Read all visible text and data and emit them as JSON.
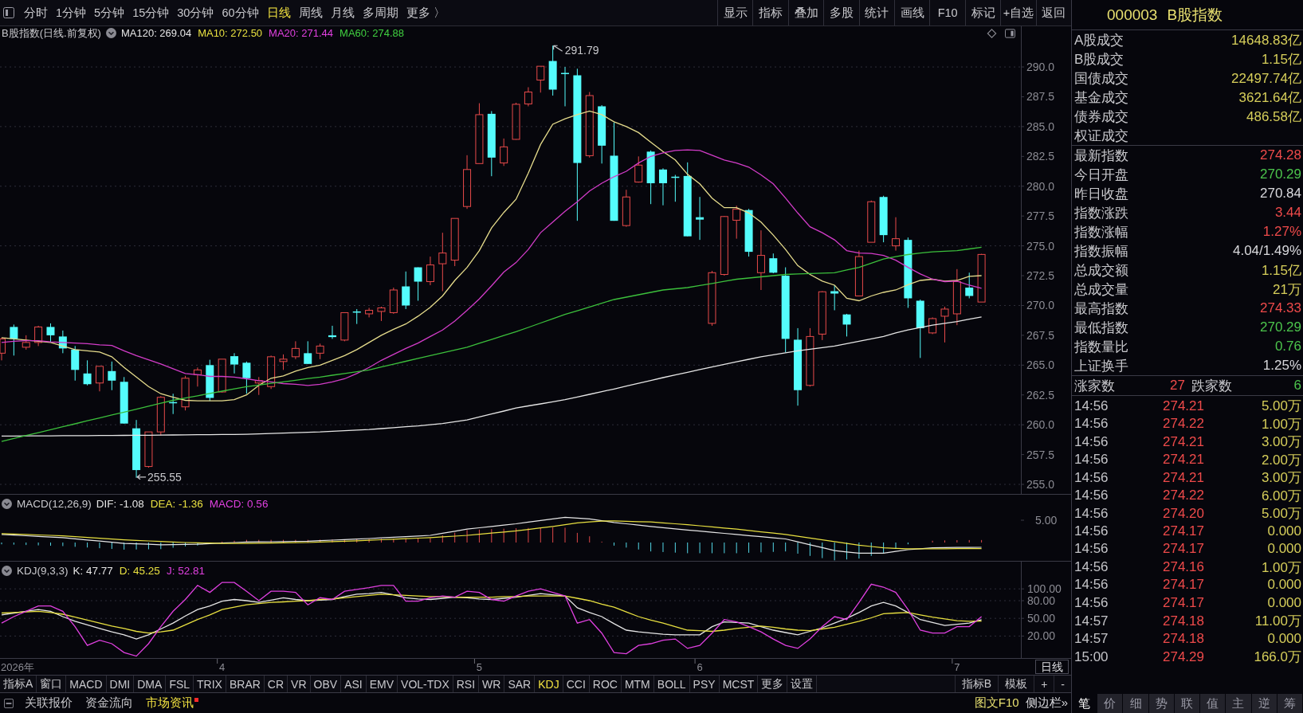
{
  "toolbar": {
    "periods": [
      {
        "label": "分时",
        "selected": false
      },
      {
        "label": "1分钟",
        "selected": false
      },
      {
        "label": "5分钟",
        "selected": false
      },
      {
        "label": "15分钟",
        "selected": false
      },
      {
        "label": "30分钟",
        "selected": false
      },
      {
        "label": "60分钟",
        "selected": false
      },
      {
        "label": "日线",
        "selected": true
      },
      {
        "label": "周线",
        "selected": false
      },
      {
        "label": "月线",
        "selected": false
      },
      {
        "label": "多周期",
        "selected": false
      },
      {
        "label": "更多 〉",
        "selected": false
      }
    ],
    "tools": [
      "显示",
      "指标",
      "叠加",
      "多股",
      "统计",
      "画线",
      "F10",
      "标记",
      "+自选",
      "返回"
    ]
  },
  "main_pane": {
    "title": "B股指数(日线.前复权)",
    "legend": [
      {
        "label": "MA120: 269.04",
        "color": "#e6e6e6"
      },
      {
        "label": "MA10: 272.50",
        "color": "#e8e040"
      },
      {
        "label": "MA20: 271.44",
        "color": "#e040e0"
      },
      {
        "label": "MA60: 274.88",
        "color": "#40d040"
      }
    ],
    "chart_data": [
      {
        "type": "candlestick",
        "ylim": [
          254.2,
          293.41
        ],
        "grid": true,
        "yticks": [
          {
            "value": 255,
            "label": "255.0"
          },
          {
            "value": 257.5,
            "label": "257.5"
          },
          {
            "value": 260,
            "label": "260.0"
          },
          {
            "value": 262.5,
            "label": "262.5"
          },
          {
            "value": 265,
            "label": "265.0"
          },
          {
            "value": 267.5,
            "label": "267.5"
          },
          {
            "value": 270,
            "label": "270.0"
          },
          {
            "value": 272.5,
            "label": "272.5"
          },
          {
            "value": 275,
            "label": "275.0"
          },
          {
            "value": 277.5,
            "label": "277.5"
          },
          {
            "value": 280,
            "label": "280.0"
          },
          {
            "value": 282.5,
            "label": "282.5"
          },
          {
            "value": 285,
            "label": "285.0"
          },
          {
            "value": 287.5,
            "label": "287.5"
          },
          {
            "value": 290,
            "label": "290.0"
          }
        ],
        "annotations": [
          "291.79",
          "255.55"
        ],
        "ohlc": [
          [
            266.0,
            267.3,
            265.4,
            267.2
          ],
          [
            268.2,
            268.4,
            265.8,
            267.2
          ],
          [
            266.5,
            267.5,
            266.3,
            266.9
          ],
          [
            266.9,
            268.3,
            266.6,
            268.2
          ],
          [
            268.2,
            268.5,
            266.9,
            267.5
          ],
          [
            267.4,
            267.9,
            266.0,
            266.4
          ],
          [
            266.3,
            266.6,
            263.7,
            264.6
          ],
          [
            264.3,
            265.4,
            263.3,
            263.4
          ],
          [
            263.5,
            264.9,
            262.8,
            264.9
          ],
          [
            264.5,
            265.3,
            262.9,
            263.7
          ],
          [
            263.6,
            264.0,
            260.1,
            260.1
          ],
          [
            259.7,
            260.4,
            255.55,
            256.2
          ],
          [
            256.5,
            259.4,
            256.4,
            259.4
          ],
          [
            259.4,
            262.4,
            259.1,
            262.3
          ],
          [
            261.9,
            262.6,
            260.9,
            261.8
          ],
          [
            261.5,
            264.1,
            261.2,
            263.9
          ],
          [
            264.2,
            264.8,
            263.2,
            264.6
          ],
          [
            265.0,
            265.45,
            262.0,
            262.25
          ],
          [
            262.75,
            265.5,
            262.7,
            265.5
          ],
          [
            265.75,
            266.0,
            264.3,
            265.05
          ],
          [
            265.2,
            265.3,
            262.6,
            263.9
          ],
          [
            263.5,
            264.0,
            262.5,
            263.7
          ],
          [
            263.2,
            265.8,
            263.0,
            265.7
          ],
          [
            265.3,
            265.9,
            264.6,
            265.5
          ],
          [
            265.7,
            267.0,
            265.5,
            266.4
          ],
          [
            266.0,
            267.0,
            265.1,
            265.1
          ],
          [
            266.0,
            266.8,
            265.5,
            266.6
          ],
          [
            267.5,
            268.3,
            267.2,
            267.35
          ],
          [
            267.1,
            269.4,
            267.0,
            269.4
          ],
          [
            269.5,
            269.7,
            268.45,
            269.4
          ],
          [
            269.3,
            269.8,
            269.0,
            269.6
          ],
          [
            269.5,
            269.9,
            268.7,
            269.8
          ],
          [
            269.4,
            271.5,
            269.3,
            271.3
          ],
          [
            271.6,
            272.85,
            269.7,
            270.0
          ],
          [
            273.2,
            273.2,
            270.4,
            272.0
          ],
          [
            272.0,
            274.1,
            271.7,
            273.4
          ],
          [
            273.5,
            276.1,
            271.2,
            274.4
          ],
          [
            273.8,
            277.3,
            273.3,
            277.3
          ],
          [
            278.3,
            282.6,
            278.1,
            281.4
          ],
          [
            281.9,
            286.96,
            281.9,
            286.0
          ],
          [
            286.07,
            286.3,
            280.84,
            282.4
          ],
          [
            281.95,
            284.0,
            281.7,
            283.3
          ],
          [
            283.93,
            287.0,
            283.9,
            286.87
          ],
          [
            286.9,
            288.3,
            286.7,
            287.9
          ],
          [
            288.9,
            290.06,
            287.85,
            290.06
          ],
          [
            290.5,
            291.79,
            287.6,
            288.1
          ],
          [
            289.5,
            290.0,
            286.7,
            289.4
          ],
          [
            289.3,
            289.85,
            277.1,
            281.95
          ],
          [
            282.56,
            287.9,
            282.4,
            287.6
          ],
          [
            286.7,
            286.8,
            281.9,
            283.4
          ],
          [
            282.56,
            285.35,
            277.1,
            277.1
          ],
          [
            276.7,
            279.7,
            276.6,
            279.1
          ],
          [
            280.35,
            282.5,
            280.3,
            281.77
          ],
          [
            282.9,
            283.0,
            278.5,
            280.25
          ],
          [
            281.4,
            281.5,
            278.4,
            280.25
          ],
          [
            280.8,
            280.95,
            278.7,
            280.7
          ],
          [
            280.86,
            282.0,
            275.8,
            275.8
          ],
          [
            277.4,
            279.1,
            275.5,
            277.2
          ],
          [
            268.5,
            272.9,
            268.3,
            272.75
          ],
          [
            272.6,
            277.5,
            272.5,
            277.46
          ],
          [
            277.15,
            278.37,
            275.6,
            278.07
          ],
          [
            278.0,
            278.1,
            274.1,
            274.5
          ],
          [
            272.75,
            276.3,
            271.3,
            274.2
          ],
          [
            273.96,
            274.36,
            272.7,
            272.75
          ],
          [
            272.5,
            273.2,
            266.07,
            267.2
          ],
          [
            267.13,
            268.1,
            261.6,
            262.9
          ],
          [
            263.3,
            268.1,
            263.2,
            267.4
          ],
          [
            267.6,
            271.2,
            267.1,
            271.15
          ],
          [
            271.2,
            271.7,
            269.6,
            271.0
          ],
          [
            269.25,
            269.3,
            267.4,
            268.4
          ],
          [
            270.8,
            274.6,
            270.8,
            274.1
          ],
          [
            275.3,
            278.8,
            275.3,
            278.7
          ],
          [
            279.1,
            279.2,
            275.3,
            275.9
          ],
          [
            275.0,
            277.4,
            274.6,
            275.6
          ],
          [
            275.5,
            275.7,
            269.8,
            270.6
          ],
          [
            270.4,
            270.5,
            265.6,
            268.1
          ],
          [
            267.7,
            269.0,
            267.6,
            268.9
          ],
          [
            269.1,
            269.9,
            266.9,
            269.7
          ],
          [
            269.3,
            273.05,
            268.35,
            272.0
          ],
          [
            271.5,
            272.75,
            270.6,
            270.8
          ],
          [
            270.29,
            274.33,
            270.29,
            274.28
          ]
        ],
        "series": [
          {
            "type": "line",
            "color": "#e6e6e6",
            "values": [
              259.05,
              259.05,
              259.06,
              259.06,
              259.07,
              259.08,
              259.08,
              259.09,
              259.1,
              259.1,
              259.11,
              259.12,
              259.12,
              259.13,
              259.14,
              259.15,
              259.16,
              259.17,
              259.18,
              259.19,
              259.2,
              259.23,
              259.27,
              259.3,
              259.33,
              259.37,
              259.4,
              259.45,
              259.5,
              259.55,
              259.6,
              259.68,
              259.75,
              259.83,
              259.9,
              260.0,
              260.1,
              260.25,
              260.4,
              260.65,
              260.9,
              261.15,
              261.4,
              261.58,
              261.75,
              261.93,
              262.1,
              262.33,
              262.55,
              262.78,
              263.0,
              263.24,
              263.48,
              263.71,
              263.95,
              264.18,
              264.4,
              264.63,
              264.85,
              265.06,
              265.28,
              265.49,
              265.7,
              265.87,
              266.03,
              266.2,
              266.33,
              266.47,
              266.6,
              266.8,
              267.0,
              267.2,
              267.4,
              267.7,
              267.95,
              268.15,
              268.35,
              268.5,
              268.65,
              268.85,
              269.04
            ]
          },
          {
            "type": "line",
            "color": "#e6dc8c",
            "values": [
              267.3,
              267.2,
              267.1,
              267.0,
              266.9,
              266.6,
              266.3,
              266.2,
              266.1,
              265.7,
              264.8,
              264.0,
              263.2,
              262.6,
              262.3,
              262.05,
              262.0,
              262.0,
              262.0,
              262.1,
              262.5,
              263.3,
              263.9,
              264.1,
              264.5,
              264.8,
              265.0,
              265.4,
              265.8,
              266.3,
              266.9,
              267.5,
              268.0,
              268.45,
              269.1,
              269.85,
              270.8,
              272.1,
              273.2,
              274.6,
              276.5,
              277.8,
              278.9,
              281.1,
              283.5,
              285.2,
              285.65,
              286.0,
              286.3,
              286.0,
              285.4,
              285.0,
              284.5,
              283.7,
              282.9,
              282.2,
              281.0,
              280.2,
              279.0,
              278.2,
              278.2,
              277.76,
              277.0,
              275.9,
              274.7,
              273.35,
              272.6,
              272.05,
              271.7,
              270.6,
              270.4,
              270.8,
              271.1,
              271.3,
              271.75,
              272.1,
              272.2,
              272.05,
              272.1,
              272.45,
              272.5
            ]
          },
          {
            "type": "line",
            "color": "#d23cc8",
            "values": [
              266.9,
              267.0,
              267.05,
              267.05,
              266.95,
              266.9,
              266.85,
              266.8,
              266.7,
              266.65,
              266.2,
              265.8,
              265.45,
              265.1,
              264.7,
              264.3,
              264.2,
              264.05,
              264.05,
              264.0,
              263.85,
              263.7,
              263.6,
              263.45,
              263.4,
              263.3,
              263.4,
              263.6,
              263.85,
              264.3,
              264.8,
              265.4,
              265.9,
              266.4,
              266.85,
              267.4,
              267.95,
              268.7,
              269.6,
              270.55,
              271.65,
              272.8,
              273.6,
              274.7,
              276.1,
              277.0,
              277.9,
              278.7,
              279.6,
              280.25,
              280.8,
              281.25,
              281.95,
              282.5,
              282.8,
              283.0,
              283.05,
              283.0,
              282.6,
              282.2,
              281.95,
              281.6,
              280.95,
              280.2,
              279.0,
              277.76,
              276.6,
              276.1,
              275.5,
              274.6,
              274.4,
              274.36,
              274.2,
              273.8,
              273.2,
              272.65,
              272.2,
              272.0,
              272.05,
              271.7,
              271.44
            ]
          },
          {
            "type": "line",
            "color": "#3cc03c",
            "values": [
              258.6,
              258.85,
              259.1,
              259.34,
              259.59,
              259.83,
              260.08,
              260.33,
              260.57,
              260.82,
              261.06,
              261.31,
              261.56,
              261.8,
              262.05,
              262.24,
              262.43,
              262.62,
              262.82,
              263.01,
              263.2,
              263.33,
              263.47,
              263.6,
              263.73,
              263.87,
              264.0,
              264.15,
              264.3,
              264.45,
              264.6,
              264.84,
              265.08,
              265.32,
              265.56,
              265.8,
              266.03,
              266.27,
              266.5,
              266.83,
              267.15,
              267.48,
              267.8,
              268.16,
              268.53,
              268.89,
              269.25,
              269.56,
              269.88,
              270.19,
              270.5,
              270.7,
              270.9,
              271.1,
              271.3,
              271.4,
              271.5,
              271.68,
              271.85,
              272.03,
              272.2,
              272.3,
              272.4,
              272.5,
              272.6,
              272.64,
              272.68,
              272.71,
              272.75,
              272.98,
              273.2,
              273.55,
              273.9,
              274.09,
              274.27,
              274.39,
              274.5,
              274.55,
              274.6,
              274.74,
              274.88
            ]
          }
        ]
      }
    ]
  },
  "macd_pane": {
    "title": "MACD(12,26,9)",
    "legend": [
      {
        "label": "DIF: -1.08",
        "color": "#e6e6e6"
      },
      {
        "label": "DEA: -1.36",
        "color": "#e8e040"
      },
      {
        "label": "MACD: 0.56",
        "color": "#e040e0"
      }
    ],
    "scale_label": "5.00"
  },
  "kdj_pane": {
    "title": "KDJ(9,3,3)",
    "legend": [
      {
        "label": "K: 47.77",
        "color": "#e6e6e6"
      },
      {
        "label": "D: 45.25",
        "color": "#e8e040"
      },
      {
        "label": "J: 52.81",
        "color": "#e040e0"
      }
    ],
    "year_label": "2026年",
    "period_button": "日线",
    "chart_data": [
      {
        "type": "line",
        "ylim": [
          -17.3,
          146.2
        ],
        "grid": true,
        "yticks": [
          {
            "value": 20,
            "label": "20.00"
          },
          {
            "value": 50,
            "label": "50.00"
          },
          {
            "value": 80,
            "label": "80.00"
          },
          {
            "value": 100,
            "label": "100.00"
          }
        ],
        "categories": [
          null,
          null,
          null,
          null,
          null,
          null,
          null,
          null,
          null,
          null,
          null,
          null,
          null,
          null,
          null,
          null,
          null,
          null,
          "4",
          null,
          null,
          null,
          null,
          null,
          null,
          null,
          null,
          null,
          null,
          null,
          null,
          null,
          null,
          null,
          null,
          null,
          null,
          null,
          null,
          "5",
          null,
          null,
          null,
          null,
          null,
          null,
          null,
          null,
          null,
          null,
          null,
          null,
          null,
          null,
          null,
          null,
          null,
          "6",
          null,
          null,
          null,
          null,
          null,
          null,
          null,
          null,
          null,
          null,
          null,
          null,
          null,
          null,
          null,
          null,
          null,
          null,
          null,
          null,
          "7",
          null,
          null
        ],
        "series": [
          {
            "color": "#e6e6e6",
            "values": [
              56,
              59,
              62,
              65,
              62,
              53,
              45,
              39,
              33,
              27,
              22,
              15,
              22,
              32,
              42,
              54,
              65,
              71,
              79,
              82,
              80,
              77,
              81,
              85,
              82,
              80,
              81,
              82,
              87,
              91,
              92,
              94,
              90,
              85,
              83,
              82,
              84,
              86,
              85,
              83,
              82,
              84,
              86,
              89,
              92,
              90,
              88,
              68,
              60,
              53,
              41,
              30,
              27,
              25,
              23,
              22,
              22,
              22,
              36,
              44,
              43,
              42,
              36,
              30,
              26,
              22,
              28,
              34,
              42,
              50,
              60,
              71,
              77,
              71,
              60,
              48,
              43,
              38,
              40,
              42,
              47.77
            ]
          },
          {
            "color": "#e8e040",
            "values": [
              59,
              60,
              61,
              62,
              60,
              57,
              52,
              47,
              42,
              37,
              33,
              28,
              25,
              27,
              30,
              39,
              48,
              56,
              65,
              69,
              73,
              75,
              77,
              78,
              79,
              80,
              82,
              83,
              85,
              87,
              89,
              91,
              90,
              89,
              88,
              87,
              87,
              86,
              86,
              86,
              86,
              87,
              87,
              88,
              88,
              88,
              88,
              84,
              80,
              74,
              69,
              61,
              53,
              47,
              42,
              36,
              30,
              29,
              28,
              30,
              33,
              35,
              37,
              35,
              32,
              30,
              29,
              32,
              35,
              40,
              45,
              51,
              58,
              59,
              60,
              56,
              52,
              49,
              46,
              45,
              45.25
            ]
          },
          {
            "color": "#e040e0",
            "values": [
              42,
              53,
              62,
              71,
              71,
              62,
              36,
              4,
              13,
              7,
              -8,
              -14,
              7,
              36,
              62,
              82,
              106,
              94,
              111,
              111,
              96,
              80,
              96,
              96,
              94,
              73,
              85,
              82,
              96,
              99,
              102,
              106,
              106,
              79,
              79,
              85,
              88,
              86,
              96,
              94,
              82,
              79,
              88,
              96,
              100,
              94,
              88,
              42,
              48,
              25,
              -8,
              -10,
              4,
              7,
              13,
              15,
              -1,
              4,
              25,
              48,
              44,
              36,
              27,
              15,
              4,
              -1,
              15,
              36,
              53,
              48,
              77,
              108,
              103,
              94,
              65,
              30,
              25,
              25,
              36,
              36,
              52.81
            ]
          }
        ]
      }
    ]
  },
  "indicator_tabs": {
    "tabs": [
      {
        "label": "指标A",
        "selected": false
      },
      {
        "label": "窗口",
        "selected": false
      },
      {
        "label": "MACD",
        "selected": false
      },
      {
        "label": "DMI",
        "selected": false
      },
      {
        "label": "DMA",
        "selected": false
      },
      {
        "label": "FSL",
        "selected": false
      },
      {
        "label": "TRIX",
        "selected": false
      },
      {
        "label": "BRAR",
        "selected": false
      },
      {
        "label": "CR",
        "selected": false
      },
      {
        "label": "VR",
        "selected": false
      },
      {
        "label": "OBV",
        "selected": false
      },
      {
        "label": "ASI",
        "selected": false
      },
      {
        "label": "EMV",
        "selected": false
      },
      {
        "label": "VOL-TDX",
        "selected": false
      },
      {
        "label": "RSI",
        "selected": false
      },
      {
        "label": "WR",
        "selected": false
      },
      {
        "label": "SAR",
        "selected": false
      },
      {
        "label": "KDJ",
        "selected": true
      },
      {
        "label": "CCI",
        "selected": false
      },
      {
        "label": "ROC",
        "selected": false
      },
      {
        "label": "MTM",
        "selected": false
      },
      {
        "label": "BOLL",
        "selected": false
      },
      {
        "label": "PSY",
        "selected": false
      },
      {
        "label": "MCST",
        "selected": false
      },
      {
        "label": "更多",
        "selected": false
      },
      {
        "label": "设置",
        "selected": false
      }
    ],
    "right_tabs": [
      "指标B",
      "模板",
      "+",
      "-"
    ]
  },
  "status_bar": {
    "tabs": [
      {
        "label": "关联报价",
        "selected": false,
        "alert": false
      },
      {
        "label": "资金流向",
        "selected": false,
        "alert": false
      },
      {
        "label": "市场资讯",
        "selected": true,
        "alert": true
      }
    ],
    "links": [
      {
        "label": "图文F10",
        "selected": true
      },
      {
        "label": "侧边栏»",
        "selected": false
      }
    ]
  },
  "quote_panel": {
    "code": "000003",
    "name": "B股指数",
    "turnover": [
      {
        "label": "A股成交",
        "value": "14648.83亿",
        "color": "#d6ce5a"
      },
      {
        "label": "B股成交",
        "value": "1.15亿",
        "color": "#d6ce5a"
      },
      {
        "label": "国债成交",
        "value": "22497.74亿",
        "color": "#d6ce5a"
      },
      {
        "label": "基金成交",
        "value": "3621.64亿",
        "color": "#d6ce5a"
      },
      {
        "label": "债券成交",
        "value": "486.58亿",
        "color": "#d6ce5a"
      },
      {
        "label": "权证成交"
      }
    ],
    "stats": [
      {
        "label": "最新指数",
        "value": "274.28",
        "color": "#ee4a4a"
      },
      {
        "label": "今日开盘",
        "value": "270.29",
        "color": "#4cc44c"
      },
      {
        "label": "昨日收盘",
        "value": "270.84",
        "color": "#d8d8dc"
      },
      {
        "label": "指数涨跌",
        "value": "3.44",
        "color": "#ee4a4a"
      },
      {
        "label": "指数涨幅",
        "value": "1.27%",
        "color": "#ee4a4a"
      },
      {
        "label": "指数振幅",
        "value": "4.04/1.49%",
        "color": "#d8d8dc"
      },
      {
        "label": "总成交额",
        "value": "1.15亿",
        "color": "#d6ce5a"
      },
      {
        "label": "总成交量",
        "value": "21万",
        "color": "#d6ce5a"
      },
      {
        "label": "最高指数",
        "value": "274.33",
        "color": "#ee4a4a"
      },
      {
        "label": "最低指数",
        "value": "270.29",
        "color": "#4cc44c"
      },
      {
        "label": "指数量比",
        "value": "0.76",
        "color": "#4cc44c"
      },
      {
        "label": "上证换手",
        "value": "1.25%",
        "color": "#d8d8dc"
      }
    ],
    "breadth": {
      "up_label": "涨家数",
      "up_count": "27",
      "down_label": "跌家数",
      "down_count": "6"
    },
    "ticks": [
      {
        "time": "14:56",
        "price": "274.21",
        "volume": "5.00万",
        "color": "#ee4a4a"
      },
      {
        "time": "14:56",
        "price": "274.22",
        "volume": "1.00万",
        "color": "#ee4a4a"
      },
      {
        "time": "14:56",
        "price": "274.21",
        "volume": "3.00万",
        "color": "#ee4a4a"
      },
      {
        "time": "14:56",
        "price": "274.21",
        "volume": "2.00万",
        "color": "#ee4a4a"
      },
      {
        "time": "14:56",
        "price": "274.21",
        "volume": "3.00万",
        "color": "#ee4a4a"
      },
      {
        "time": "14:56",
        "price": "274.22",
        "volume": "6.00万",
        "color": "#ee4a4a"
      },
      {
        "time": "14:56",
        "price": "274.20",
        "volume": "5.00万",
        "color": "#ee4a4a"
      },
      {
        "time": "14:56",
        "price": "274.17",
        "volume": "0.000",
        "color": "#ee4a4a"
      },
      {
        "time": "14:56",
        "price": "274.17",
        "volume": "0.000",
        "color": "#ee4a4a"
      },
      {
        "time": "14:56",
        "price": "274.16",
        "volume": "1.00万",
        "color": "#ee4a4a"
      },
      {
        "time": "14:56",
        "price": "274.17",
        "volume": "0.000",
        "color": "#ee4a4a"
      },
      {
        "time": "14:56",
        "price": "274.17",
        "volume": "0.000",
        "color": "#ee4a4a"
      },
      {
        "time": "14:57",
        "price": "274.18",
        "volume": "11.00万",
        "color": "#ee4a4a"
      },
      {
        "time": "14:57",
        "price": "274.18",
        "volume": "0.000",
        "color": "#ee4a4a"
      },
      {
        "time": "15:00",
        "price": "274.29",
        "volume": "166.0万",
        "color": "#ee4a4a"
      }
    ],
    "tabs": [
      {
        "label": "笔",
        "selected": true
      },
      {
        "label": "价",
        "selected": false
      },
      {
        "label": "细",
        "selected": false
      },
      {
        "label": "势",
        "selected": false
      },
      {
        "label": "联",
        "selected": false
      },
      {
        "label": "值",
        "selected": false
      },
      {
        "label": "主",
        "selected": false
      },
      {
        "label": "逆",
        "selected": false
      },
      {
        "label": "筹",
        "selected": false
      }
    ]
  }
}
